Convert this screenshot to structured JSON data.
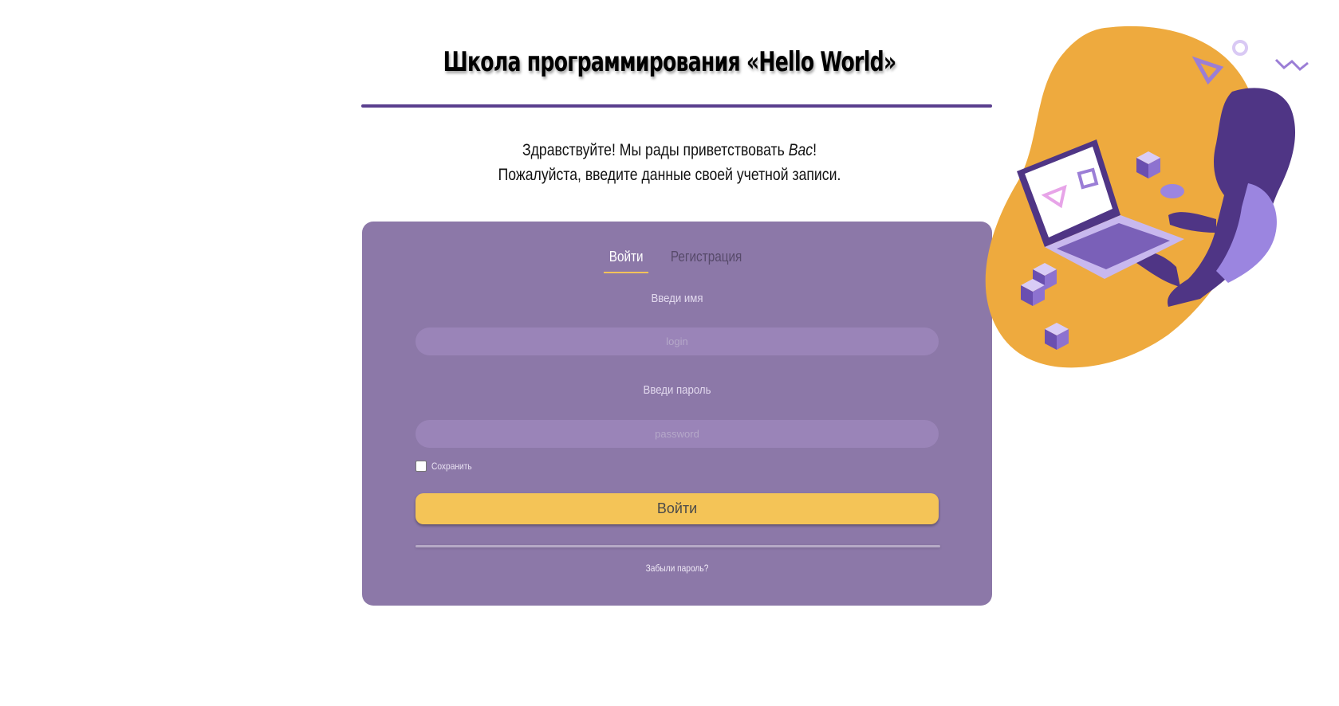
{
  "header": {
    "title": "Школа программирования «Hello World»"
  },
  "greeting": {
    "line1_start": "Здравствуйте! Мы рады приветствовать",
    "line1_you": "Вас",
    "line1_end": "!",
    "line2": "Пожалуйста, введите данные своей учетной записи."
  },
  "tabs": [
    {
      "label": "Войти",
      "active": true
    },
    {
      "label": "Регистрация",
      "active": false
    }
  ],
  "form": {
    "username_label": "Введи имя",
    "username_placeholder": "login",
    "password_label": "Введи пароль",
    "password_placeholder": "password",
    "remember_label": "Сохранить",
    "remember_checked": false,
    "submit_label": "Войти",
    "forgot_label": "Забыли пароль?"
  },
  "colors": {
    "card": "#8c78a8",
    "accent": "#f4c457",
    "rule": "#5a3f8e",
    "blob": "#eeaa3e",
    "figure": "#4f3585"
  },
  "illustration": {
    "icon": "person-with-laptop-illustration"
  }
}
